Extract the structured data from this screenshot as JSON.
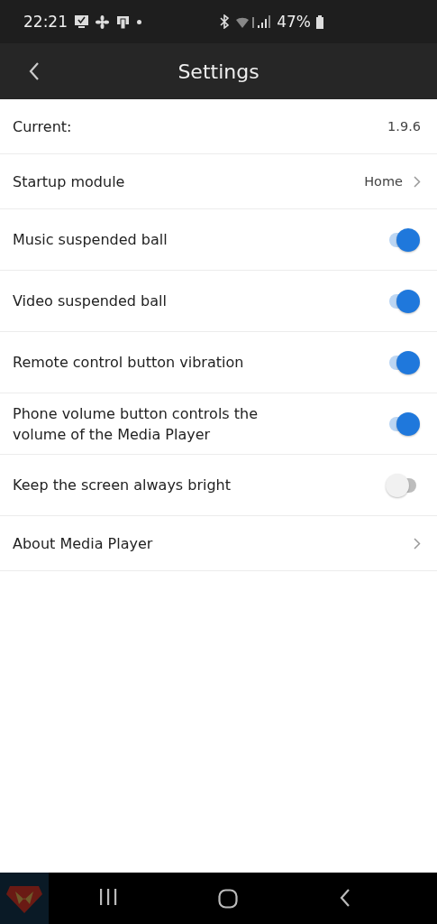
{
  "status_bar": {
    "time": "22:21",
    "battery": "47%"
  },
  "header": {
    "title": "Settings"
  },
  "rows": [
    {
      "kind": "value",
      "label": "Current:",
      "value": "1.9.6"
    },
    {
      "kind": "link",
      "label": "Startup module",
      "value": "Home"
    },
    {
      "kind": "toggle",
      "label": "Music suspended ball",
      "on": true
    },
    {
      "kind": "toggle",
      "label": "Video suspended ball",
      "on": true
    },
    {
      "kind": "toggle",
      "label": "Remote control button vibration",
      "on": true
    },
    {
      "kind": "toggle",
      "label": "Phone volume button controls the volume of the Media Player",
      "on": true
    },
    {
      "kind": "toggle",
      "label": "Keep the screen always bright",
      "on": false
    },
    {
      "kind": "link",
      "label": "About Media Player"
    }
  ]
}
